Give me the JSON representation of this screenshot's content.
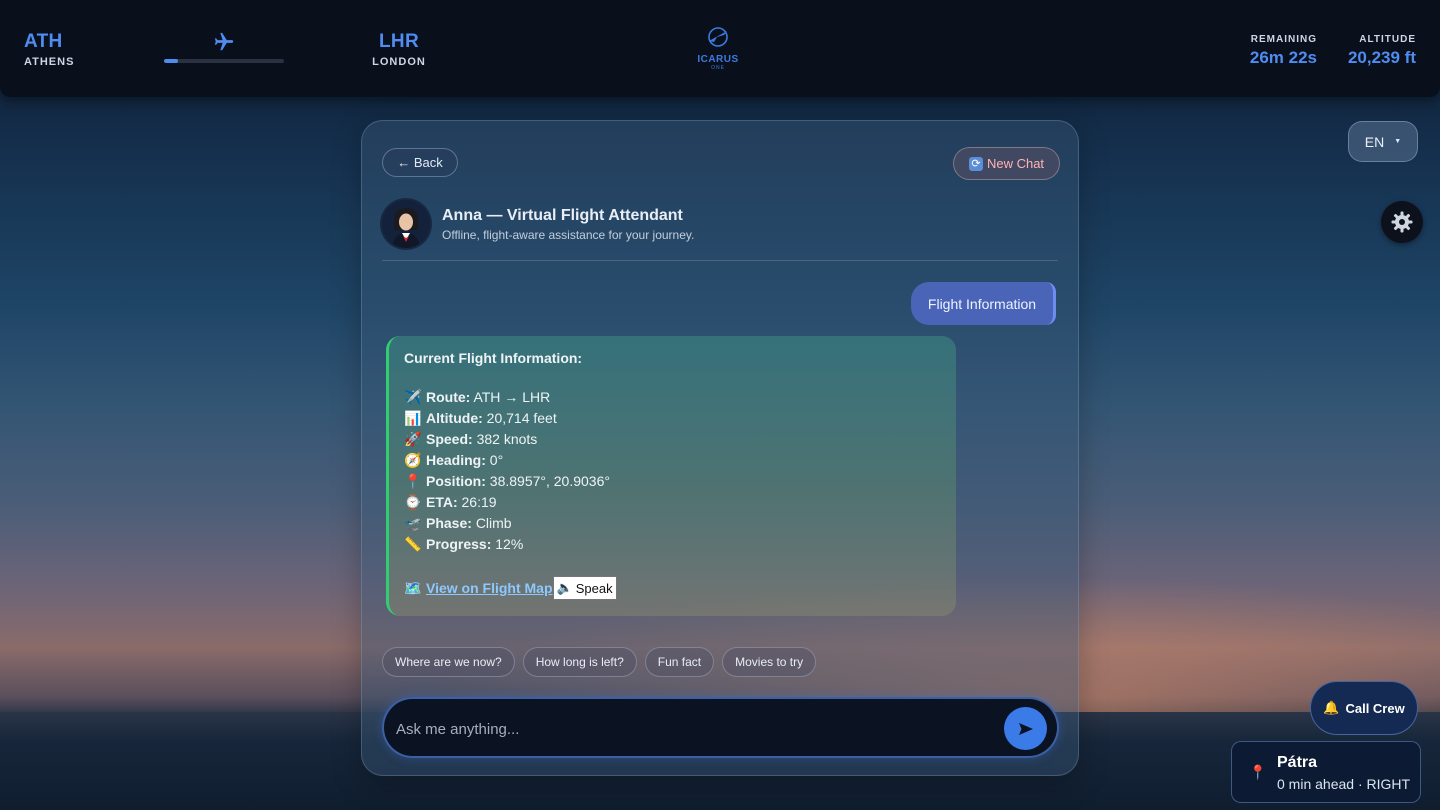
{
  "header": {
    "origin": {
      "code": "ATH",
      "city": "ATHENS"
    },
    "destination": {
      "code": "LHR",
      "city": "LONDON"
    },
    "progress": 0.12,
    "logo": {
      "name": "ICARUS",
      "sub": "ONE"
    },
    "remaining": {
      "label": "REMAINING",
      "value": "26m 22s"
    },
    "altitude": {
      "label": "ALTITUDE",
      "value": "20,239 ft"
    }
  },
  "language": {
    "selected": "EN"
  },
  "chat": {
    "back_label": "← Back",
    "new_chat_label": "New Chat",
    "attendant": {
      "name": "Anna — Virtual Flight Attendant",
      "subtitle": "Offline, flight-aware assistance for your journey."
    },
    "user_message": "Flight Information",
    "bot_message": {
      "heading": "Current Flight Information:",
      "lines": [
        {
          "emoji": "✈️",
          "label": "Route:",
          "value": "ATH → LHR"
        },
        {
          "emoji": "📊",
          "label": "Altitude:",
          "value": "20,714 feet"
        },
        {
          "emoji": "🚀",
          "label": "Speed:",
          "value": "382 knots"
        },
        {
          "emoji": "🧭",
          "label": "Heading:",
          "value": "0°"
        },
        {
          "emoji": "📍",
          "label": "Position:",
          "value": "38.8957°, 20.9036°"
        },
        {
          "emoji": "⌚",
          "label": "ETA:",
          "value": "26:19"
        },
        {
          "emoji": "🛫",
          "label": "Phase:",
          "value": "Climb"
        },
        {
          "emoji": "📏",
          "label": "Progress:",
          "value": "12%"
        }
      ],
      "map_link": "View on Flight Map",
      "map_emoji": "🗺️",
      "speak_label": "Speak",
      "speak_emoji": "🔈"
    },
    "suggestions": [
      "Where are we now?",
      "How long is left?",
      "Fun fact",
      "Movies to try"
    ],
    "input": {
      "placeholder": "Ask me anything...",
      "value": ""
    }
  },
  "call_crew": {
    "label": "Call Crew",
    "emoji": "🔔"
  },
  "poi": {
    "name": "Pátra",
    "detail": "0 min ahead · RIGHT",
    "emoji": "📍"
  },
  "colors": {
    "accent": "#4f8cf0",
    "panel_border_bot": "#2fcf6f",
    "user_bubble": "#4a64b8"
  }
}
